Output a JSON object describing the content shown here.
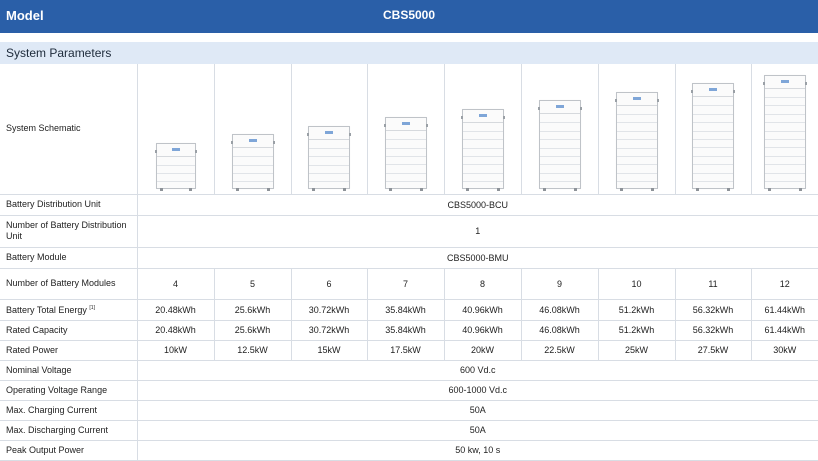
{
  "header": {
    "model_label": "Model",
    "product": "CBS5000"
  },
  "section": {
    "title": "System Parameters"
  },
  "schematic": {
    "label": "System Schematic",
    "module_counts": [
      4,
      5,
      6,
      7,
      8,
      9,
      10,
      11,
      12
    ]
  },
  "rows": {
    "bdu": {
      "label": "Battery Distribution Unit",
      "value": "CBS5000-BCU"
    },
    "num_bdu": {
      "label": "Number of Battery Distribution Unit",
      "value": "1"
    },
    "module": {
      "label": "Battery Module",
      "value": "CBS5000-BMU"
    },
    "num_modules": {
      "label": "Number of Battery Modules",
      "values": [
        "4",
        "5",
        "6",
        "7",
        "8",
        "9",
        "10",
        "11",
        "12"
      ]
    },
    "energy": {
      "label": "Battery Total Energy",
      "note": "[1]",
      "values": [
        "20.48kWh",
        "25.6kWh",
        "30.72kWh",
        "35.84kWh",
        "40.96kWh",
        "46.08kWh",
        "51.2kWh",
        "56.32kWh",
        "61.44kWh"
      ]
    },
    "capacity": {
      "label": "Rated Capacity",
      "values": [
        "20.48kWh",
        "25.6kWh",
        "30.72kWh",
        "35.84kWh",
        "40.96kWh",
        "46.08kWh",
        "51.2kWh",
        "56.32kWh",
        "61.44kWh"
      ]
    },
    "power": {
      "label": "Rated Power",
      "values": [
        "10kW",
        "12.5kW",
        "15kW",
        "17.5kW",
        "20kW",
        "22.5kW",
        "25kW",
        "27.5kW",
        "30kW"
      ]
    },
    "voltage": {
      "label": "Nominal Voltage",
      "value": "600 Vd.c"
    },
    "op_voltage": {
      "label": "Operating Voltage Range",
      "value": "600-1000 Vd.c"
    },
    "charge": {
      "label": "Max. Charging Current",
      "value": "50A"
    },
    "discharge": {
      "label": "Max. Discharging Current",
      "value": "50A"
    },
    "peak": {
      "label": "Peak Output Power",
      "value": "50 kw, 10 s"
    }
  }
}
